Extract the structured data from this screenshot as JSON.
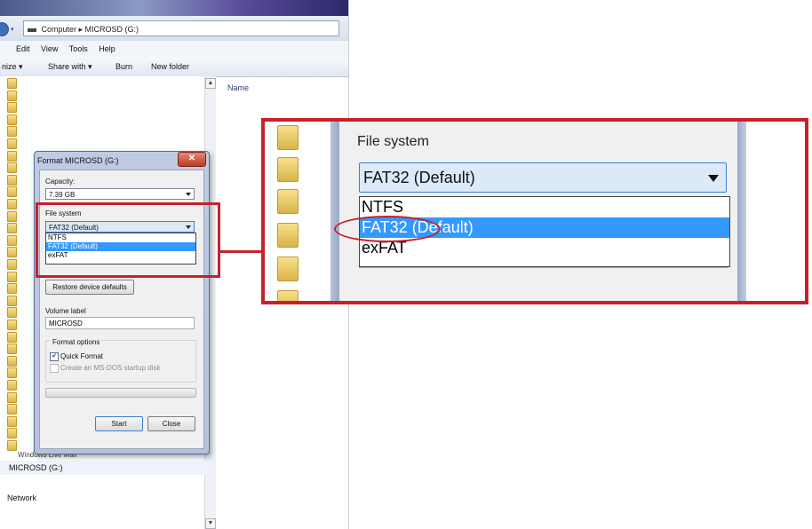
{
  "explorer": {
    "address": "Computer ▸ MICROSD (G:)",
    "menu": [
      "Edit",
      "View",
      "Tools",
      "Help"
    ],
    "commands": [
      "nize ▾",
      "Share with ▾",
      "Burn",
      "New folder"
    ],
    "column_name": "Name",
    "windows_live_mail": "Windows Live Mail",
    "drive_item": "MICROSD (G:)",
    "network": "Network"
  },
  "dialog": {
    "title": "Format MICROSD (G:)",
    "close_label": "✕",
    "capacity_label": "Capacity:",
    "capacity_value": "7.39 GB",
    "filesystem_label": "File system",
    "filesystem_value": "FAT32 (Default)",
    "filesystem_options": [
      "NTFS",
      "FAT32 (Default)",
      "exFAT"
    ],
    "restore_button": "Restore device defaults",
    "volume_label": "Volume label",
    "volume_value": "MICROSD",
    "format_options_label": "Format options",
    "quick_format": "Quick Format",
    "msdos_disk": "Create an MS-DOS startup disk",
    "start_button": "Start",
    "close_button": "Close"
  },
  "zoom": {
    "label": "File system",
    "value": "FAT32 (Default)",
    "options": [
      "NTFS",
      "FAT32 (Default)",
      "exFAT"
    ]
  },
  "colors": {
    "highlight_red": "#c8202a",
    "selection_blue": "#3399ff"
  }
}
